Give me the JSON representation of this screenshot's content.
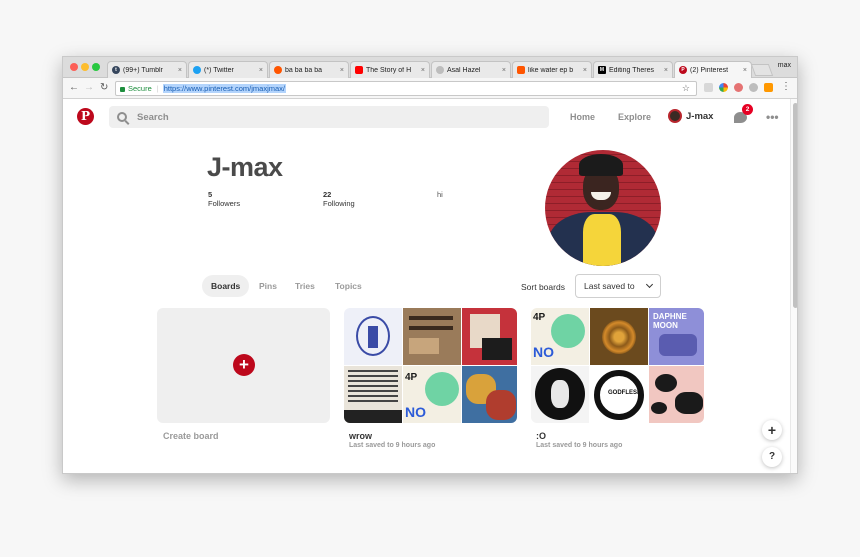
{
  "browser": {
    "tabs": [
      {
        "title": "(99+) Tumblr",
        "icon": "tumblr-icon",
        "color": "#36465d"
      },
      {
        "title": "(*) Twitter",
        "icon": "twitter-icon",
        "color": "#1da1f2"
      },
      {
        "title": "ba ba ba ba",
        "icon": "soundcloud-icon",
        "color": "#ff5500"
      },
      {
        "title": "The Story of H",
        "icon": "youtube-icon",
        "color": "#ff0000"
      },
      {
        "title": "Asal Hazel",
        "icon": "generic-page-icon",
        "color": "#bdbdbd"
      },
      {
        "title": "like water ep b",
        "icon": "soundcloud-icon",
        "color": "#ff5500"
      },
      {
        "title": "Editing Theres",
        "icon": "medium-icon",
        "color": "#000000"
      },
      {
        "title": "(2) Pinterest",
        "icon": "pinterest-icon",
        "color": "#bd081c"
      }
    ],
    "profile_name": "max",
    "secure_label": "Secure",
    "url": "https://www.pinterest.com/jmaxjmax/"
  },
  "header": {
    "search_placeholder": "Search",
    "home": "Home",
    "explore": "Explore",
    "username": "J-max",
    "notification_count": "2",
    "brand_color": "#bd081c"
  },
  "profile": {
    "name": "J-max",
    "followers_count": "5",
    "followers_label": "Followers",
    "following_count": "22",
    "following_label": "Following",
    "bio": "hi"
  },
  "tabs": {
    "boards": "Boards",
    "pins": "Pins",
    "tries": "Tries",
    "topics": "Topics"
  },
  "sort": {
    "label": "Sort boards",
    "selected": "Last saved to"
  },
  "boards": [
    {
      "title": "Create board"
    },
    {
      "title": "wrow",
      "subtitle": "Last saved to 9 hours ago"
    },
    {
      "title": ":O",
      "subtitle": "Last saved to 9 hours ago"
    }
  ],
  "fab": {
    "add": "+",
    "help": "?"
  }
}
